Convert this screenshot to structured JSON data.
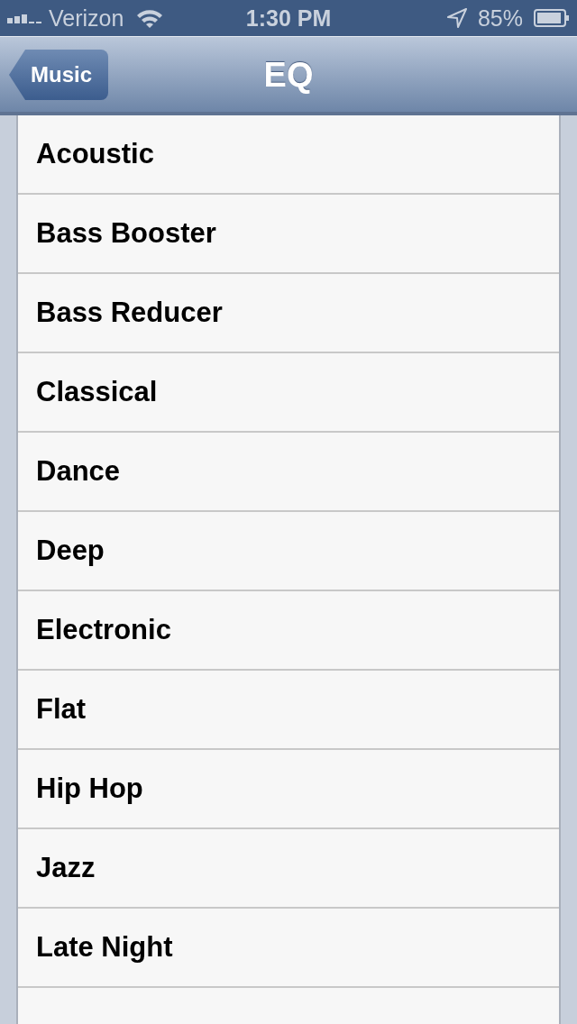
{
  "status_bar": {
    "carrier": "Verizon",
    "time": "1:30 PM",
    "battery": "85%"
  },
  "nav_bar": {
    "back_button": "Music",
    "title": "EQ"
  },
  "presets": [
    "Acoustic",
    "Bass Booster",
    "Bass Reducer",
    "Classical",
    "Dance",
    "Deep",
    "Electronic",
    "Flat",
    "Hip Hop",
    "Jazz",
    "Late Night"
  ]
}
